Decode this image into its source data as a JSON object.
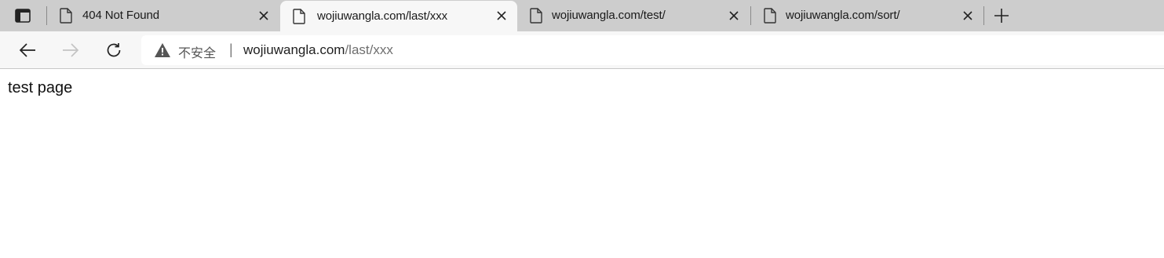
{
  "tabs": [
    {
      "title": "404 Not Found",
      "active": false
    },
    {
      "title": "wojiuwangla.com/last/xxx",
      "active": true
    },
    {
      "title": "wojiuwangla.com/test/",
      "active": false
    },
    {
      "title": "wojiuwangla.com/sort/",
      "active": false
    }
  ],
  "addressbar": {
    "security_label": "不安全",
    "separator": "|",
    "url_host": "wojiuwangla.com",
    "url_path": "/last/xxx"
  },
  "page": {
    "body_text": "test page"
  },
  "icons": {
    "tab_actions": "tab-actions-icon",
    "favicon": "document-icon",
    "close": "close-icon",
    "new_tab": "plus-icon",
    "back": "arrow-left-icon",
    "forward": "arrow-right-icon",
    "refresh": "refresh-icon",
    "warning": "warning-icon"
  },
  "colors": {
    "tabstrip_bg": "#cdcdcd",
    "active_tab_bg": "#f7f7f7",
    "toolbar_bg": "#f7f7f7",
    "url_path": "#6f6f6f"
  }
}
